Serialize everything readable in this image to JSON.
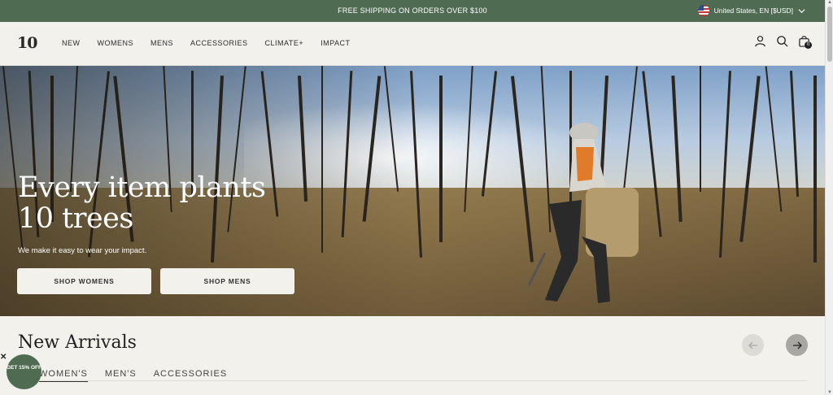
{
  "announcement": {
    "message": "FREE SHIPPING ON ORDERS OVER $100",
    "locale": "United States, EN [$USD]"
  },
  "header": {
    "logo": "10",
    "nav": [
      "NEW",
      "WOMENS",
      "MENS",
      "ACCESSORIES",
      "CLIMATE+",
      "IMPACT"
    ],
    "cart_count": "0",
    "icons": [
      "account-icon",
      "search-icon",
      "bag-icon"
    ]
  },
  "hero": {
    "title_line1": "Every item plants",
    "title_line2": "10 trees",
    "subtitle": "We make it easy to wear your impact.",
    "btn_womens": "SHOP WOMENS",
    "btn_mens": "SHOP MENS"
  },
  "arrivals": {
    "title": "New Arrivals",
    "tabs": [
      "WOMEN'S",
      "MEN'S",
      "ACCESSORIES"
    ],
    "active_tab": "WOMEN'S"
  },
  "promo": {
    "label": "GET 15% OFF"
  },
  "colors": {
    "brand_green": "#4f6b52",
    "background": "#f2f1ec"
  }
}
